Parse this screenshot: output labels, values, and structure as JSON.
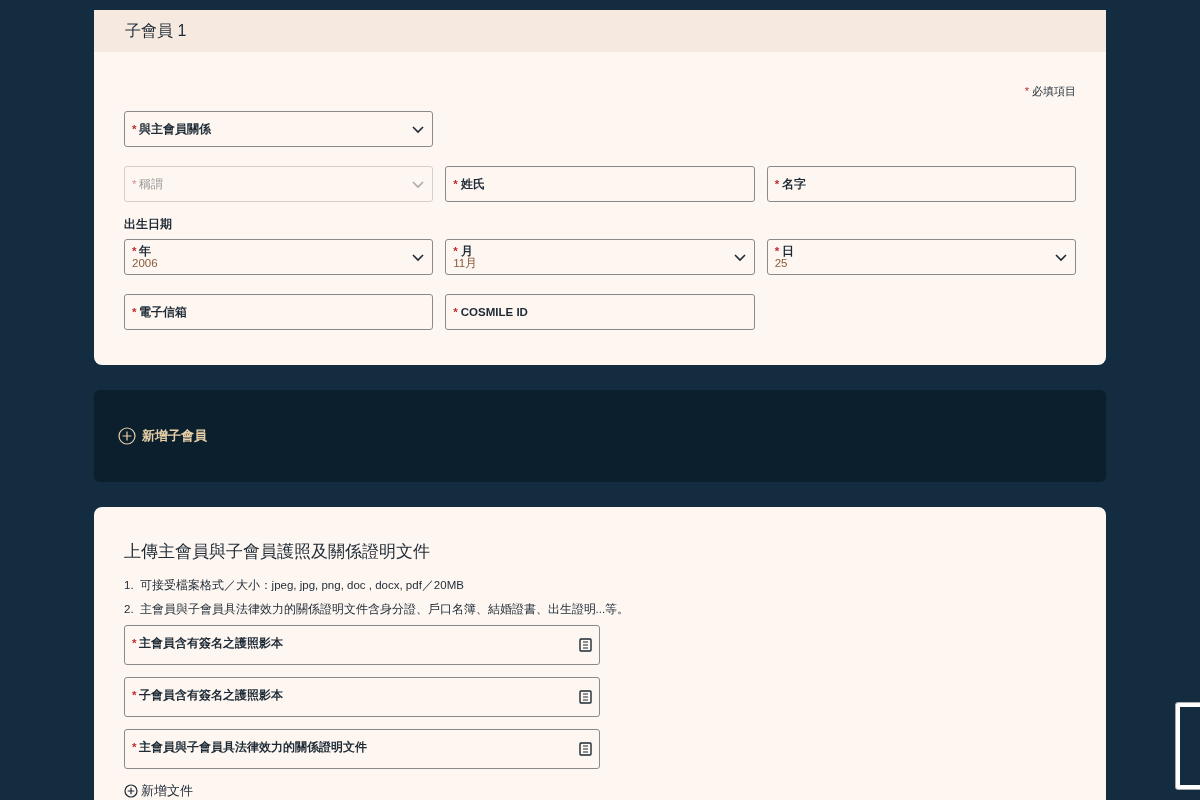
{
  "member_card": {
    "title": "子會員 1",
    "required_note": {
      "mark": "*",
      "text": "必填項目"
    },
    "rows": [
      {
        "fields": [
          {
            "kind": "select",
            "mark": "*",
            "label": "與主會員關係",
            "disabled": false
          }
        ]
      },
      {
        "fields": [
          {
            "kind": "select",
            "mark": "*",
            "label": "稱謂",
            "disabled": true
          },
          {
            "kind": "input",
            "mark": "*",
            "label": "姓氏",
            "disabled": false
          },
          {
            "kind": "input",
            "mark": "*",
            "label": "名字",
            "disabled": false
          }
        ]
      },
      {
        "heading": "出生日期",
        "fields": [
          {
            "kind": "select",
            "mark": "*",
            "label": "年",
            "value": "2006",
            "disabled": false
          },
          {
            "kind": "select",
            "mark": "*",
            "label": "月",
            "value": "11月",
            "disabled": false
          },
          {
            "kind": "select",
            "mark": "*",
            "label": "日",
            "value": "25",
            "disabled": false
          }
        ]
      },
      {
        "fields": [
          {
            "kind": "input",
            "mark": "*",
            "label": "電子信箱",
            "disabled": false
          },
          {
            "kind": "input",
            "mark": "*",
            "label": "COSMILE ID",
            "disabled": false
          }
        ]
      }
    ]
  },
  "add_member": {
    "label": "新增子會員"
  },
  "upload": {
    "title": "上傳主會員與子會員護照及關係證明文件",
    "notes": [
      {
        "number": "1.",
        "text": "可接受檔案格式／大小：jpeg, jpg, png, doc , docx, pdf／20MB"
      },
      {
        "number": "2.",
        "text": "主會員與子會員具法律效力的關係證明文件含身分證、戶口名簿、結婚證書、出生證明...等。"
      }
    ],
    "files": [
      {
        "mark": "*",
        "label": "主會員含有簽名之護照影本"
      },
      {
        "mark": "*",
        "label": "子會員含有簽名之護照影本"
      },
      {
        "mark": "*",
        "label": "主會員與子會員具法律效力的關係證明文件"
      }
    ],
    "add_file": "新增文件"
  }
}
